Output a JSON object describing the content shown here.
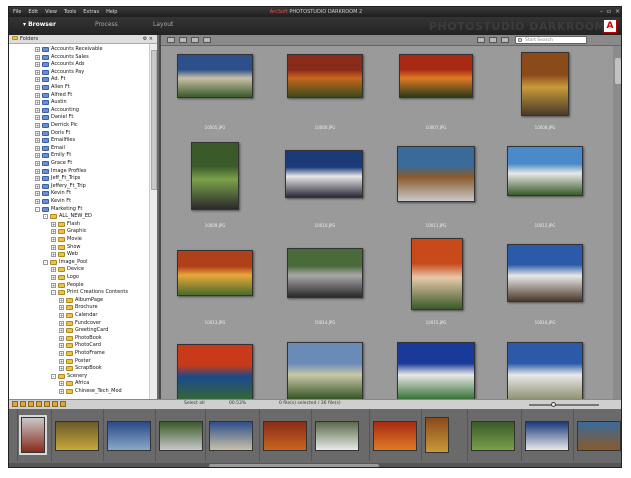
{
  "menu": [
    "File",
    "Edit",
    "View",
    "Tools",
    "Extras",
    "Help"
  ],
  "window_title_brand": "ArcSoft",
  "window_title_rest": "PHOTOSTUDIO DARKROOM 2",
  "modes": {
    "browser": "Browser",
    "process": "Process",
    "layout": "Layout"
  },
  "brand_text": "PHOTOSTUDIO DARKROOM",
  "folders_label": "Folders",
  "search_placeholder": "Start Search",
  "tree": [
    {
      "label": "Accounts Receivable",
      "depth": 3,
      "icon": "user",
      "toggle": "+"
    },
    {
      "label": "Accounts Sales",
      "depth": 3,
      "icon": "user",
      "toggle": "+"
    },
    {
      "label": "Accounts Ads",
      "depth": 3,
      "icon": "user",
      "toggle": "+"
    },
    {
      "label": "Accounts Pay",
      "depth": 3,
      "icon": "user",
      "toggle": "+"
    },
    {
      "label": "Ad. Ft",
      "depth": 3,
      "icon": "user",
      "toggle": "+"
    },
    {
      "label": "Allen Ft",
      "depth": 3,
      "icon": "user",
      "toggle": "+"
    },
    {
      "label": "Alfred Ft",
      "depth": 3,
      "icon": "user",
      "toggle": "+"
    },
    {
      "label": "Austin",
      "depth": 3,
      "icon": "user",
      "toggle": "+"
    },
    {
      "label": "Accounting",
      "depth": 3,
      "icon": "user",
      "toggle": "+"
    },
    {
      "label": "Daniel Ft",
      "depth": 3,
      "icon": "user",
      "toggle": "+"
    },
    {
      "label": "Derrick Pic",
      "depth": 3,
      "icon": "user",
      "toggle": "+"
    },
    {
      "label": "Doris Ft",
      "depth": 3,
      "icon": "user",
      "toggle": "+"
    },
    {
      "label": "Emailfiles",
      "depth": 3,
      "icon": "user",
      "toggle": "+"
    },
    {
      "label": "Email",
      "depth": 3,
      "icon": "user",
      "toggle": "+"
    },
    {
      "label": "Emily Ft",
      "depth": 3,
      "icon": "user",
      "toggle": "+"
    },
    {
      "label": "Grace Ft",
      "depth": 3,
      "icon": "user",
      "toggle": "+"
    },
    {
      "label": "Image Profiles",
      "depth": 3,
      "icon": "user",
      "toggle": "+"
    },
    {
      "label": "Jeff_Ft_Trips",
      "depth": 3,
      "icon": "user",
      "toggle": "+"
    },
    {
      "label": "Jeffery_Ft_Trip",
      "depth": 3,
      "icon": "user",
      "toggle": "+"
    },
    {
      "label": "Kevin Ft",
      "depth": 3,
      "icon": "user",
      "toggle": "+"
    },
    {
      "label": "Kevin Ft",
      "depth": 3,
      "icon": "user",
      "toggle": "+"
    },
    {
      "label": "Marketing Ft",
      "depth": 3,
      "icon": "user",
      "toggle": "-"
    },
    {
      "label": "ALL_NEW_ED",
      "depth": 4,
      "icon": "folder",
      "toggle": "-"
    },
    {
      "label": "Flash",
      "depth": 5,
      "icon": "folder",
      "toggle": "+"
    },
    {
      "label": "Graphic",
      "depth": 5,
      "icon": "folder",
      "toggle": "+"
    },
    {
      "label": "Movie",
      "depth": 5,
      "icon": "folder",
      "toggle": "+"
    },
    {
      "label": "Show",
      "depth": 5,
      "icon": "folder",
      "toggle": "+"
    },
    {
      "label": "Web",
      "depth": 5,
      "icon": "folder",
      "toggle": "+"
    },
    {
      "label": "Image_Pool",
      "depth": 4,
      "icon": "folder",
      "toggle": "-"
    },
    {
      "label": "Device",
      "depth": 5,
      "icon": "folder",
      "toggle": "+"
    },
    {
      "label": "Logo",
      "depth": 5,
      "icon": "folder",
      "toggle": "+"
    },
    {
      "label": "People",
      "depth": 5,
      "icon": "folder",
      "toggle": "+"
    },
    {
      "label": "Print Creations Contents",
      "depth": 5,
      "icon": "folder",
      "toggle": "-"
    },
    {
      "label": "AlbumPage",
      "depth": 6,
      "icon": "folder",
      "toggle": "+"
    },
    {
      "label": "Brochure",
      "depth": 6,
      "icon": "folder",
      "toggle": "+"
    },
    {
      "label": "Calendar",
      "depth": 6,
      "icon": "folder",
      "toggle": "+"
    },
    {
      "label": "Fundcover",
      "depth": 6,
      "icon": "folder",
      "toggle": "+"
    },
    {
      "label": "GreetingCard",
      "depth": 6,
      "icon": "folder",
      "toggle": "+"
    },
    {
      "label": "PhotoBook",
      "depth": 6,
      "icon": "folder",
      "toggle": "+"
    },
    {
      "label": "PhotoCard",
      "depth": 6,
      "icon": "folder",
      "toggle": "+"
    },
    {
      "label": "PhotoFrame",
      "depth": 6,
      "icon": "folder",
      "toggle": "+"
    },
    {
      "label": "Poster",
      "depth": 6,
      "icon": "folder",
      "toggle": "+"
    },
    {
      "label": "ScrapBook",
      "depth": 6,
      "icon": "folder",
      "toggle": "+"
    },
    {
      "label": "Scenery",
      "depth": 5,
      "icon": "folder",
      "toggle": "-"
    },
    {
      "label": "Africa",
      "depth": 6,
      "icon": "folder",
      "toggle": "+"
    },
    {
      "label": "Chinese_Tech_Mod",
      "depth": 6,
      "icon": "folder",
      "toggle": "+"
    }
  ],
  "thumbnails": [
    {
      "file": "10005.JPG",
      "colors": [
        "#2d4f8a",
        "#c8c0a8",
        "#3a5a2a"
      ]
    },
    {
      "file": "10006.JPG",
      "colors": [
        "#8a2a1a",
        "#c8661e",
        "#3a4a1a"
      ]
    },
    {
      "file": "10007.JPG",
      "colors": [
        "#a82a14",
        "#e07a24",
        "#2a3a1a"
      ]
    },
    {
      "file": "10008.JPG",
      "colors": [
        "#8a4a1a",
        "#c89a3a",
        "#4a3a2a"
      ]
    },
    {
      "file": "10009.JPG",
      "colors": [
        "#3a5a2a",
        "#7aa04a",
        "#2a2a2a"
      ]
    },
    {
      "file": "10010.JPG",
      "colors": [
        "#1a3a7a",
        "#e8e8e8",
        "#2a2a3a"
      ]
    },
    {
      "file": "10011.JPG",
      "colors": [
        "#3a6a9a",
        "#8a5a2a",
        "#c8c8c8"
      ]
    },
    {
      "file": "10012.JPG",
      "colors": [
        "#4a8ac8",
        "#e8e8e8",
        "#3a5a2a"
      ]
    },
    {
      "file": "10013.JPG",
      "colors": [
        "#b0401a",
        "#e8a83a",
        "#4a6a2a"
      ]
    },
    {
      "file": "10014.JPG",
      "colors": [
        "#4a6a3a",
        "#a8a8a8",
        "#2a2a2a"
      ]
    },
    {
      "file": "10015.JPG",
      "colors": [
        "#c84a1a",
        "#e8c8a8",
        "#3a5a2a"
      ]
    },
    {
      "file": "10016.JPG",
      "colors": [
        "#2a5aa8",
        "#e8e8e8",
        "#4a3a2a"
      ]
    },
    {
      "file": "",
      "colors": [
        "#c83a1a",
        "#1a4a8a",
        "#3a6a2a"
      ]
    },
    {
      "file": "",
      "colors": [
        "#6a8ab8",
        "#c8c8a8",
        "#2a4a1a"
      ]
    },
    {
      "file": "",
      "colors": [
        "#1a3a9a",
        "#e8e8e8",
        "#2a6a2a"
      ]
    },
    {
      "file": "",
      "colors": [
        "#2a5aa8",
        "#e8e8e8",
        "#8a8a6a"
      ]
    }
  ],
  "status": {
    "select_all": "Select all",
    "zoom": "00.53%",
    "selection": "0 file(s) selected / 36 file(s)"
  },
  "filmstrip": [
    {
      "colors": [
        "#c8c8c8",
        "#8a2a1a"
      ]
    },
    {
      "colors": [
        "#6a5a2a",
        "#c8a83a"
      ]
    },
    {
      "colors": [
        "#2a4a8a",
        "#8aa8c8"
      ]
    },
    {
      "colors": [
        "#3a5a2a",
        "#c8c8c8"
      ]
    },
    {
      "colors": [
        "#2d4f8a",
        "#c8c0a8"
      ]
    },
    {
      "colors": [
        "#8a2a1a",
        "#c8661e"
      ]
    },
    {
      "colors": [
        "#5a6a4a",
        "#e8e8e8"
      ]
    },
    {
      "colors": [
        "#a82a14",
        "#e07a24"
      ]
    },
    {
      "colors": [
        "#8a4a1a",
        "#c89a3a"
      ]
    },
    {
      "colors": [
        "#3a5a2a",
        "#7aa04a"
      ]
    },
    {
      "colors": [
        "#1a3a7a",
        "#e8e8e8"
      ]
    },
    {
      "colors": [
        "#3a6a9a",
        "#8a5a2a"
      ]
    },
    {
      "colors": [
        "#4a8ac8",
        "#e8e8e8"
      ]
    }
  ],
  "colors": {
    "accent": "#e05050",
    "panel": "#9a9a9a",
    "chrome": "#2a2a2a"
  }
}
